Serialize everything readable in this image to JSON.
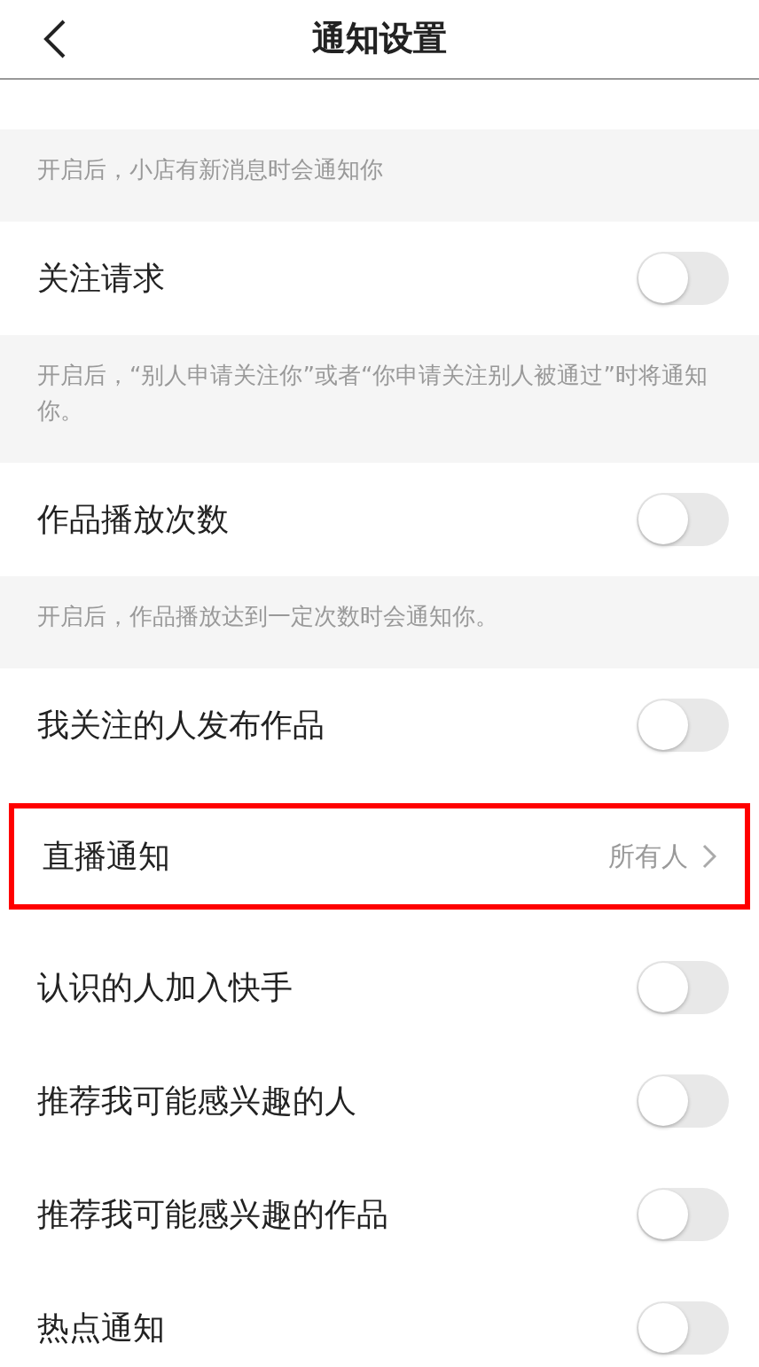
{
  "header": {
    "title": "通知设置"
  },
  "items": [
    {
      "kind": "note",
      "text": "开启后，小店有新消息时会通知你"
    },
    {
      "kind": "toggle",
      "label": "关注请求",
      "on": false
    },
    {
      "kind": "note",
      "text": "开启后，“别人申请关注你”或者“你申请关注别人被通过”时将通知你。"
    },
    {
      "kind": "toggle",
      "label": "作品播放次数",
      "on": false
    },
    {
      "kind": "note",
      "text": "开启后，作品播放达到一定次数时会通知你。"
    },
    {
      "kind": "toggle",
      "label": "我关注的人发布作品",
      "on": false
    },
    {
      "kind": "link",
      "label": "直播通知",
      "value": "所有人",
      "highlighted": true
    },
    {
      "kind": "toggle",
      "label": "认识的人加入快手",
      "on": false
    },
    {
      "kind": "toggle",
      "label": "推荐我可能感兴趣的人",
      "on": false
    },
    {
      "kind": "toggle",
      "label": "推荐我可能感兴趣的作品",
      "on": false
    },
    {
      "kind": "toggle",
      "label": "热点通知",
      "on": false
    }
  ]
}
